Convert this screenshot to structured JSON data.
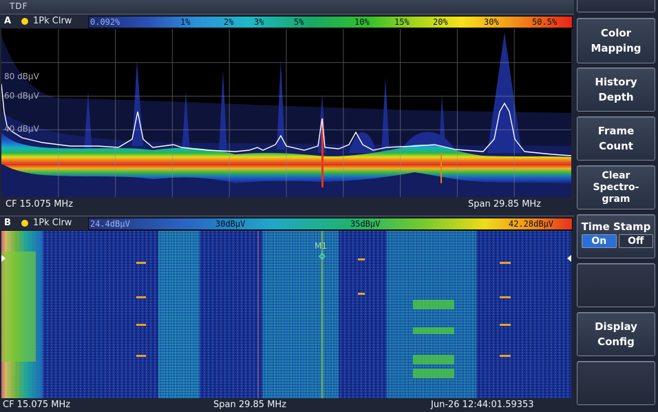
{
  "title": "TDF",
  "pane_a": {
    "letter": "A",
    "trace": "1Pk Clrw",
    "scale_ticks": [
      "0.092%",
      "1%",
      "2%",
      "3%",
      "5%",
      "10%",
      "15%",
      "20%",
      "30%",
      "50.5%"
    ],
    "y_labels": [
      "80 dBµV",
      "60 dBµV",
      "40 dBµV"
    ],
    "cf": "CF 15.075 MHz",
    "span": "Span 29.85 MHz"
  },
  "pane_b": {
    "letter": "B",
    "trace": "1Pk Clrw",
    "scale_ticks": [
      "24.4dBµV",
      "30dBµV",
      "35dBµV",
      "42.28dBµV"
    ],
    "marker": "M1",
    "cf": "CF 15.075 MHz",
    "span": "Span 29.85 MHz",
    "timestamp": "Jun-26 12:44:01.59353"
  },
  "softkeys": {
    "color_mapping": "Color\nMapping",
    "history_depth": "History\nDepth",
    "frame_count": "Frame\nCount",
    "clear_spectrogram": "Clear\nSpectro-\ngram",
    "time_stamp": "Time Stamp",
    "on": "On",
    "off": "Off",
    "display_config": "Display\nConfig"
  }
}
